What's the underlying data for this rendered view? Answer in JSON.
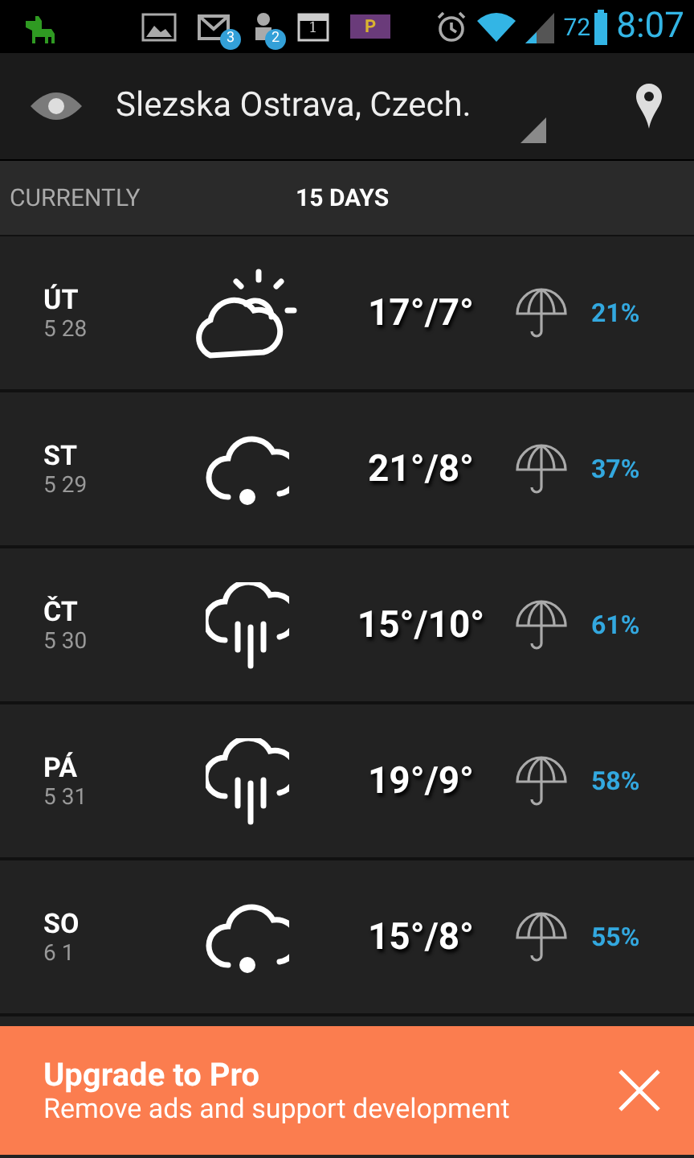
{
  "status_bar": {
    "notifications": [
      {
        "kind": "app"
      },
      {
        "kind": "gallery"
      },
      {
        "kind": "mail",
        "badge": "3"
      },
      {
        "kind": "android",
        "badge": "2"
      },
      {
        "kind": "calendar",
        "badge": "1"
      },
      {
        "kind": "tag",
        "badge": "P"
      }
    ],
    "battery": "72",
    "time": "8:07"
  },
  "header": {
    "location": "Slezska Ostrava, Czech."
  },
  "tabs": [
    {
      "label": "CURRENTLY",
      "selected": false
    },
    {
      "label": "15 DAYS",
      "selected": true
    }
  ],
  "days": [
    {
      "day": "ÚT",
      "date": "5 28",
      "kind": "partly-cloudy",
      "temp": "17°/7°",
      "precip": "21%"
    },
    {
      "day": "ST",
      "date": "5 29",
      "kind": "light-rain",
      "temp": "21°/8°",
      "precip": "37%"
    },
    {
      "day": "ČT",
      "date": "5 30",
      "kind": "rain",
      "temp": "15°/10°",
      "precip": "61%"
    },
    {
      "day": "PÁ",
      "date": "5 31",
      "kind": "rain",
      "temp": "19°/9°",
      "precip": "58%"
    },
    {
      "day": "SO",
      "date": "6 1",
      "kind": "light-rain",
      "temp": "15°/8°",
      "precip": "55%"
    }
  ],
  "banner": {
    "title": "Upgrade to Pro",
    "subtitle": "Remove ads and support development"
  }
}
